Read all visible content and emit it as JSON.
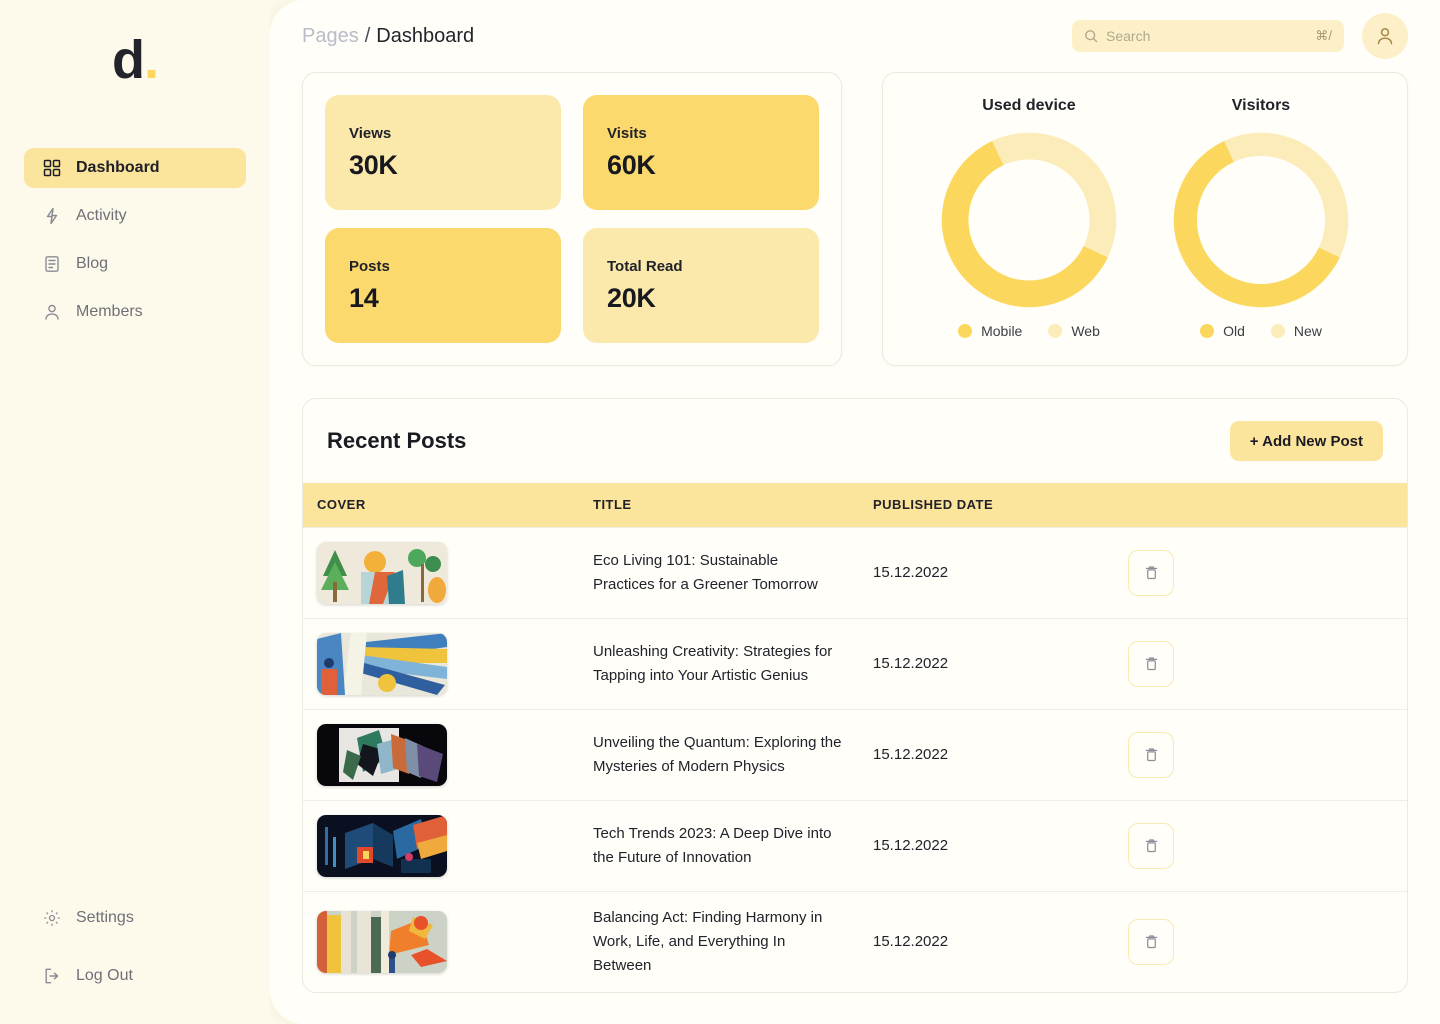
{
  "brand": {
    "letter": "d",
    "dot": "."
  },
  "colors": {
    "accent": "#fbd96c",
    "accent_light": "#fbe9ac",
    "accent_header": "#fbe49c",
    "canvas": "#fdfaeb",
    "panel": "#fffef8",
    "text": "#22222a",
    "muted": "#6f6f78"
  },
  "sidebar": {
    "items": [
      {
        "label": "Dashboard",
        "icon": "grid-icon",
        "active": true
      },
      {
        "label": "Activity",
        "icon": "bolt-icon",
        "active": false
      },
      {
        "label": "Blog",
        "icon": "document-icon",
        "active": false
      },
      {
        "label": "Members",
        "icon": "user-icon",
        "active": false
      }
    ],
    "bottom_items": [
      {
        "label": "Settings",
        "icon": "gear-icon"
      },
      {
        "label": "Log Out",
        "icon": "logout-icon"
      }
    ]
  },
  "topbar": {
    "breadcrumb_parent": "Pages",
    "breadcrumb_separator": "/",
    "breadcrumb_current": "Dashboard",
    "search_placeholder": "Search",
    "search_value": "",
    "search_shortcut": "⌘/",
    "avatar_icon": "user-icon"
  },
  "stats": [
    {
      "label": "Views",
      "value": "30K",
      "tone": "light"
    },
    {
      "label": "Visits",
      "value": "60K",
      "tone": "dark"
    },
    {
      "label": "Posts",
      "value": "14",
      "tone": "dark"
    },
    {
      "label": "Total Read",
      "value": "20K",
      "tone": "light"
    }
  ],
  "chart_data": [
    {
      "type": "pie",
      "title": "Used device",
      "categories": [
        "Mobile",
        "Web"
      ],
      "values": [
        61,
        39
      ],
      "colors": [
        "#fbd85d",
        "#fcecb9"
      ],
      "legend_position": "bottom",
      "donut": true
    },
    {
      "type": "pie",
      "title": "Visitors",
      "categories": [
        "Old",
        "New"
      ],
      "values": [
        61,
        39
      ],
      "colors": [
        "#fbd85d",
        "#fcecb9"
      ],
      "legend_position": "bottom",
      "donut": true
    }
  ],
  "posts_panel": {
    "title": "Recent Posts",
    "add_button": "+ Add New Post",
    "columns": [
      "COVER",
      "TITLE",
      "PUBLISHED DATE",
      ""
    ],
    "rows": [
      {
        "cover": "abstract-trees-cover",
        "title": "Eco Living 101: Sustainable Practices for a Greener Tomorrow",
        "date": "15.12.2022",
        "action_icon": "trash-icon"
      },
      {
        "cover": "abstract-rays-cover",
        "title": "Unleashing Creativity: Strategies for Tapping into Your Artistic Genius",
        "date": "15.12.2022",
        "action_icon": "trash-icon"
      },
      {
        "cover": "prism-dark-cover",
        "title": "Unveiling the Quantum: Exploring the Mysteries of Modern Physics",
        "date": "15.12.2022",
        "action_icon": "trash-icon"
      },
      {
        "cover": "neon-city-cover",
        "title": "Tech Trends 2023: A Deep Dive into the Future of Innovation",
        "date": "15.12.2022",
        "action_icon": "trash-icon"
      },
      {
        "cover": "balance-figures-cover",
        "title": "Balancing Act: Finding Harmony in Work, Life, and Everything In Between",
        "date": "15.12.2022",
        "action_icon": "trash-icon"
      }
    ]
  }
}
